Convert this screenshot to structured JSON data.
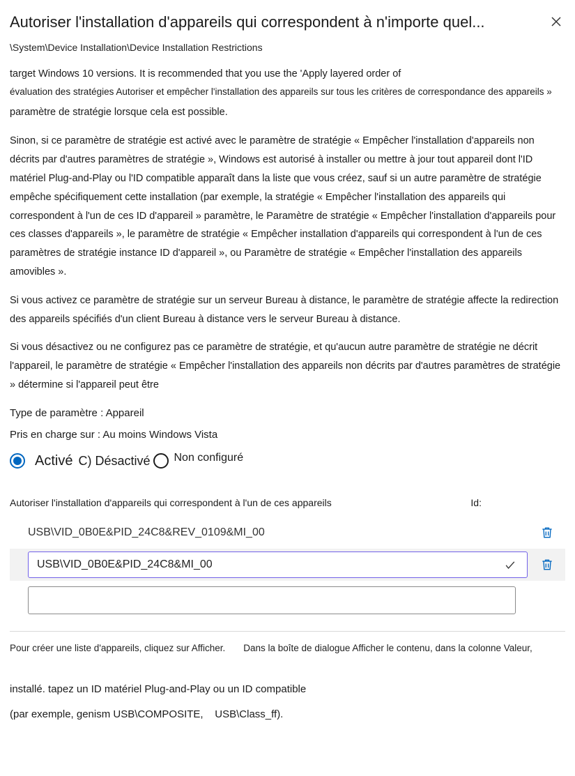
{
  "header": {
    "title": "Autoriser l'installation d'appareils qui correspondent à n'importe quel...",
    "breadcrumb": "\\System\\Device Installation\\Device Installation Restrictions"
  },
  "body": {
    "cut_line1": "target Windows 10 versions. It is recommended that you use the 'Apply layered order of",
    "line2": "évaluation des stratégies Autoriser et empêcher l'installation des appareils sur tous les critères de correspondance des appareils »",
    "line3": "paramètre de stratégie lorsque cela est possible.",
    "para2": "Sinon, si ce paramètre de stratégie est activé avec le paramètre de stratégie « Empêcher l'installation d'appareils non décrits par d'autres paramètres de stratégie », Windows est autorisé à installer ou mettre à jour tout appareil dont l'ID matériel Plug-and-Play ou l'ID compatible apparaît dans la liste que vous créez, sauf si un autre paramètre de stratégie empêche spécifiquement cette installation (par exemple, la stratégie « Empêcher l'installation des appareils qui correspondent à l'un de ces ID d'appareil » paramètre, le Paramètre de stratégie « Empêcher l'installation d'appareils pour ces classes d'appareils », le paramètre de stratégie « Empêcher installation d'appareils qui correspondent à l'un de ces paramètres de stratégie instance ID d'appareil », ou Paramètre de stratégie « Empêcher l'installation des appareils amovibles ».",
    "para3": "Si vous activez ce paramètre de stratégie sur un serveur Bureau à distance, le paramètre de stratégie affecte la redirection des appareils spécifiés d'un client Bureau à distance vers le serveur Bureau à distance.",
    "para4": "Si vous désactivez ou ne configurez pas ce paramètre de stratégie, et qu'aucun autre paramètre de stratégie ne décrit l'appareil, le paramètre de stratégie « Empêcher l'installation des appareils non décrits par d'autres paramètres de stratégie » détermine si l'appareil peut être"
  },
  "meta": {
    "type": "Type de paramètre : Appareil",
    "supported": "Pris en charge sur : Au moins Windows Vista"
  },
  "radios": {
    "enabled": "Activé",
    "disabled_marker_and_label": "C) Désactivé",
    "not_configured": "Non configuré"
  },
  "list": {
    "label_left": "Autoriser l'installation d'appareils qui correspondent à l'un de ces appareils",
    "label_right": "Id:",
    "rows": [
      {
        "text": "USB\\VID_0B0E&PID_24C8&REV_0109&MI_00",
        "editing": false
      },
      {
        "text": "USB\\VID_0B0E&PID_24C8&MI_00",
        "editing": true
      }
    ],
    "empty_placeholder": ""
  },
  "footnote": {
    "left": "Pour créer une liste d'appareils, cliquez sur Afficher.",
    "right": "Dans la boîte de dialogue Afficher le contenu, dans la colonne Valeur,"
  },
  "tail": {
    "line1": "installé. tapez un ID matériel Plug-and-Play ou un ID compatible",
    "line2a": "(par exemple, genism USB\\COMPOSITE,",
    "line2b": "USB\\Class_ff)."
  }
}
